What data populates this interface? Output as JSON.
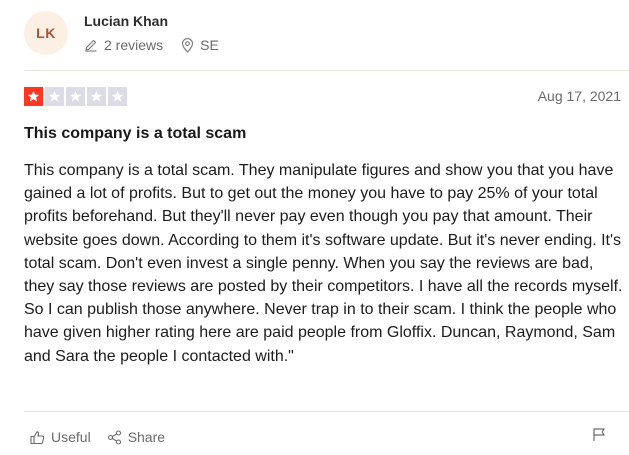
{
  "reviewer": {
    "initials": "LK",
    "name": "Lucian Khan",
    "reviews_count": "2 reviews",
    "country": "SE"
  },
  "review": {
    "rating": 1,
    "max_rating": 5,
    "date": "Aug 17, 2021",
    "title": "This company is a total scam",
    "body": "This company is a total scam. They manipulate figures and show you that you have gained a lot of profits. But to get out the money you have to pay 25% of your total profits beforehand. But they'll never pay even though you pay that amount. Their website goes down. According to them it's software update. But it's never ending. It's total scam. Don't even invest a single penny. When you say the reviews are bad, they say those reviews are posted by their competitors. I have all the records myself. So I can publish those anywhere. Never trap in to their scam. I think the people who have given higher rating here are paid people from Gloffix. Duncan, Raymond, Sam and Sara the people I contacted with.\""
  },
  "actions": {
    "useful_label": "Useful",
    "share_label": "Share"
  },
  "colors": {
    "star_filled": "#ff3722",
    "star_empty": "#dcdce6",
    "avatar_bg": "#fcefe4",
    "avatar_text": "#a8553c"
  },
  "icons": {
    "reviews": "pencil-icon",
    "location": "location-pin-icon",
    "useful": "thumbs-up-icon",
    "share": "share-icon",
    "report": "flag-icon"
  }
}
